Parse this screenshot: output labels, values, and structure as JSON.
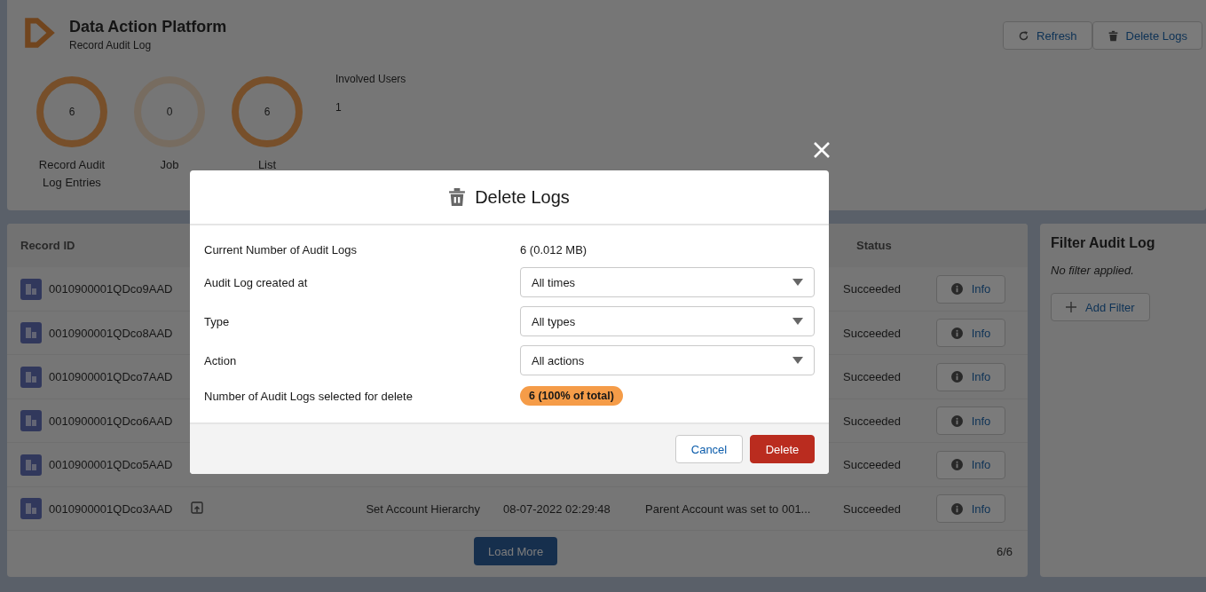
{
  "app": {
    "title": "Data Action Platform",
    "subtitle": "Record Audit Log"
  },
  "header_buttons": [
    {
      "label": "Refresh"
    },
    {
      "label": "Delete Logs"
    }
  ],
  "stats": [
    {
      "value": "6",
      "label": "Record Audit Log Entries",
      "kind": "filled"
    },
    {
      "value": "0",
      "label": "Job",
      "kind": "empty"
    },
    {
      "value": "6",
      "label": "List",
      "kind": "filled"
    }
  ],
  "involved_users": {
    "label": "Involved Users",
    "value": "1"
  },
  "table": {
    "columns": [
      "Record ID",
      "Status"
    ],
    "rows": [
      {
        "id": "0010900001QDco9AAD",
        "status": "Succeeded",
        "button": "Info"
      },
      {
        "id": "0010900001QDco8AAD",
        "status": "Succeeded",
        "button": "Info"
      },
      {
        "id": "0010900001QDco7AAD",
        "status": "Succeeded",
        "button": "Info"
      },
      {
        "id": "0010900001QDco6AAD",
        "status": "Succeeded",
        "button": "Info"
      },
      {
        "id": "0010900001QDco5AAD",
        "status": "Succeeded",
        "button": "Info"
      },
      {
        "id": "0010900001QDco3AAD",
        "action": "Set Account Hierarchy",
        "date": "08-07-2022 02:29:48",
        "message": "Parent Account was set to 001...",
        "status": "Succeeded",
        "button": "Info"
      }
    ],
    "load_more": "Load More",
    "count": "6/6"
  },
  "filter_panel": {
    "title": "Filter Audit Log",
    "note": "No filter applied.",
    "button": "Add Filter"
  },
  "modal": {
    "title": "Delete Logs",
    "fields": [
      {
        "kind": "text",
        "label": "Current Number of Audit Logs",
        "value": "6 (0.012 MB)"
      },
      {
        "kind": "select",
        "label": "Audit Log created at",
        "value": "All times"
      },
      {
        "kind": "select",
        "label": "Type",
        "value": "All types"
      },
      {
        "kind": "select",
        "label": "Action",
        "value": "All actions"
      },
      {
        "kind": "badge",
        "label": "Number of Audit Logs selected for delete",
        "value": "6 (100% of total)",
        "color": "#f59c48"
      }
    ],
    "buttons": [
      {
        "label": "Cancel",
        "kind": "neutral"
      },
      {
        "label": "Delete",
        "kind": "destructive"
      }
    ]
  }
}
